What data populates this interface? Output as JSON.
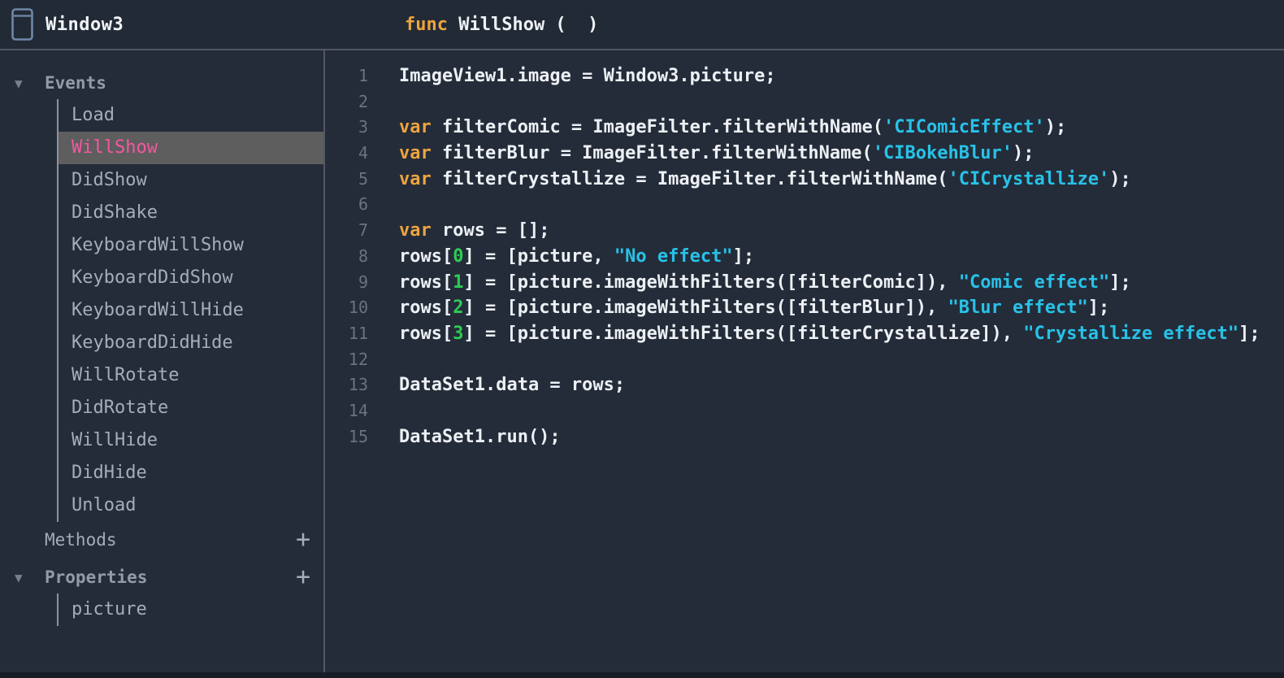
{
  "window": {
    "title": "Window3"
  },
  "signature": {
    "keyword": "func",
    "name_and_params": " WillShow (  )"
  },
  "sidebar": {
    "events": {
      "label": "Events",
      "expanded": true,
      "items": [
        {
          "label": "Load",
          "selected": false
        },
        {
          "label": "WillShow",
          "selected": true
        },
        {
          "label": "DidShow",
          "selected": false
        },
        {
          "label": "DidShake",
          "selected": false
        },
        {
          "label": "KeyboardWillShow",
          "selected": false
        },
        {
          "label": "KeyboardDidShow",
          "selected": false
        },
        {
          "label": "KeyboardWillHide",
          "selected": false
        },
        {
          "label": "KeyboardDidHide",
          "selected": false
        },
        {
          "label": "WillRotate",
          "selected": false
        },
        {
          "label": "DidRotate",
          "selected": false
        },
        {
          "label": "WillHide",
          "selected": false
        },
        {
          "label": "DidHide",
          "selected": false
        },
        {
          "label": "Unload",
          "selected": false
        }
      ]
    },
    "methods": {
      "label": "Methods",
      "add_label": "+"
    },
    "properties": {
      "label": "Properties",
      "expanded": true,
      "add_label": "+",
      "items": [
        {
          "label": "picture",
          "selected": false
        }
      ]
    }
  },
  "editor": {
    "lines": [
      {
        "no": "1",
        "tokens": [
          [
            "plain",
            "ImageView1.image = Window3.picture;"
          ]
        ]
      },
      {
        "no": "2",
        "tokens": []
      },
      {
        "no": "3",
        "tokens": [
          [
            "kw",
            "var"
          ],
          [
            "plain",
            " filterComic = ImageFilter.filterWithName("
          ],
          [
            "str",
            "'CIComicEffect'"
          ],
          [
            "plain",
            ");"
          ]
        ]
      },
      {
        "no": "4",
        "tokens": [
          [
            "kw",
            "var"
          ],
          [
            "plain",
            " filterBlur = ImageFilter.filterWithName("
          ],
          [
            "str",
            "'CIBokehBlur'"
          ],
          [
            "plain",
            ");"
          ]
        ]
      },
      {
        "no": "5",
        "tokens": [
          [
            "kw",
            "var"
          ],
          [
            "plain",
            " filterCrystallize = ImageFilter.filterWithName("
          ],
          [
            "str",
            "'CICrystallize'"
          ],
          [
            "plain",
            ");"
          ]
        ]
      },
      {
        "no": "6",
        "tokens": []
      },
      {
        "no": "7",
        "tokens": [
          [
            "kw",
            "var"
          ],
          [
            "plain",
            " rows = [];"
          ]
        ]
      },
      {
        "no": "8",
        "tokens": [
          [
            "plain",
            "rows["
          ],
          [
            "num",
            "0"
          ],
          [
            "plain",
            "] = [picture, "
          ],
          [
            "str",
            "\"No effect\""
          ],
          [
            "plain",
            "];"
          ]
        ]
      },
      {
        "no": "9",
        "tokens": [
          [
            "plain",
            "rows["
          ],
          [
            "num",
            "1"
          ],
          [
            "plain",
            "] = [picture.imageWithFilters([filterComic]), "
          ],
          [
            "str",
            "\"Comic effect\""
          ],
          [
            "plain",
            "];"
          ]
        ]
      },
      {
        "no": "10",
        "tokens": [
          [
            "plain",
            "rows["
          ],
          [
            "num",
            "2"
          ],
          [
            "plain",
            "] = [picture.imageWithFilters([filterBlur]), "
          ],
          [
            "str",
            "\"Blur effect\""
          ],
          [
            "plain",
            "];"
          ]
        ]
      },
      {
        "no": "11",
        "tokens": [
          [
            "plain",
            "rows["
          ],
          [
            "num",
            "3"
          ],
          [
            "plain",
            "] = [picture.imageWithFilters([filterCrystallize]), "
          ],
          [
            "str",
            "\"Crystallize effect\""
          ],
          [
            "plain",
            "];"
          ]
        ]
      },
      {
        "no": "12",
        "tokens": []
      },
      {
        "no": "13",
        "tokens": [
          [
            "plain",
            "DataSet1.data = rows;"
          ]
        ]
      },
      {
        "no": "14",
        "tokens": []
      },
      {
        "no": "15",
        "tokens": [
          [
            "plain",
            "DataSet1.run();"
          ]
        ]
      }
    ]
  },
  "icons": {
    "collapse_triangle": "▼",
    "window_icon": "window-frame"
  },
  "colors": {
    "background": "#242c39",
    "topbar_background": "#222a36",
    "divider": "#525863",
    "keyword": "#eda43e",
    "string": "#28c2e8",
    "number": "#2ecc54",
    "code_text": "#edf0f4",
    "line_number": "#6a7380",
    "sidebar_item": "#a6adb8",
    "section_header": "#929ba8",
    "selected_background": "#5e5e5e",
    "selected_text": "#f4579f",
    "tree_line": "#8d939d",
    "icon_stroke": "#6f88a8"
  }
}
